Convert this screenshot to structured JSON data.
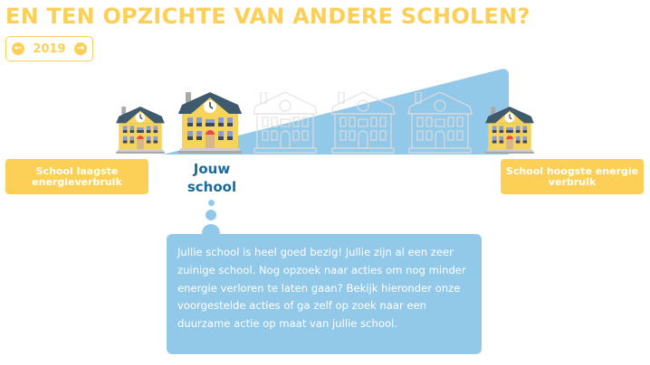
{
  "title": "EN TEN OPZICHTE VAN ANDERE SCHOLEN?",
  "year_selector": {
    "year": "2019",
    "prev_icon": "arrow-left-circle-icon",
    "next_icon": "arrow-right-circle-icon"
  },
  "scale": {
    "lowest_label": "School laagste energieverbruik",
    "highest_label": "School hoogste energie verbruik",
    "your_school_label": "Jouw school"
  },
  "message": "Jullie school is heel goed bezig! Jullie zijn al een zeer zuinige school. Nog opzoek naar acties om nog minder energie verloren te laten gaan? Bekijk hieronder onze voorgestelde acties of ga zelf op zoek naar een duurzame actie op maat van jullie school.",
  "colors": {
    "accent": "#fcd056",
    "blue": "#93c9e8",
    "dark_blue": "#1a6a9a"
  }
}
